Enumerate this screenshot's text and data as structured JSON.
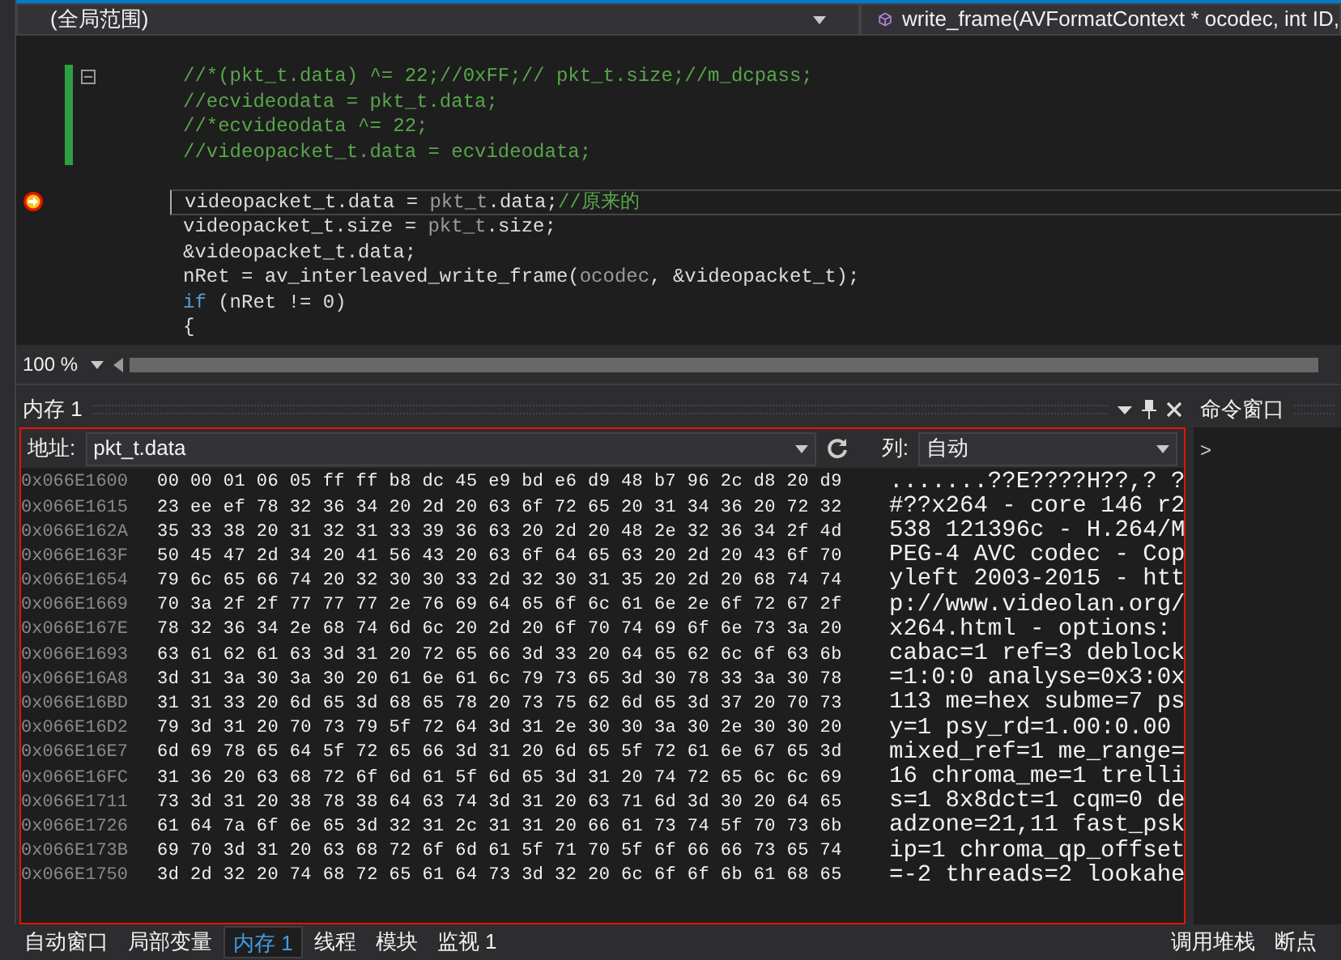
{
  "nav_bar": {
    "scope": "(全局范围)",
    "function": "write_frame(AVFormatContext * ocodec, int ID,"
  },
  "editor": {
    "lines": [
      {
        "kind": "blank"
      },
      {
        "kind": "code",
        "changed": true,
        "current": false,
        "fold": true,
        "segments": [
          {
            "kind": "comment",
            "text": "//*(pkt_t.data) ^= 22;//0xFF;// pkt_t.size;//m_dcpass;"
          }
        ]
      },
      {
        "kind": "code",
        "changed": true,
        "current": false,
        "fold": false,
        "segments": [
          {
            "kind": "comment",
            "text": "//ecvideodata = pkt_t.data;"
          }
        ]
      },
      {
        "kind": "code",
        "changed": true,
        "current": false,
        "fold": false,
        "segments": [
          {
            "kind": "comment",
            "text": "//*ecvideodata ^= 22;"
          }
        ]
      },
      {
        "kind": "code",
        "changed": true,
        "current": false,
        "fold": false,
        "segments": [
          {
            "kind": "comment",
            "text": "//videopacket_t.data = ecvideodata;"
          }
        ]
      },
      {
        "kind": "blank"
      },
      {
        "kind": "code",
        "changed": false,
        "current": true,
        "fold": false,
        "segments": [
          {
            "kind": "plain",
            "text": "videopacket_t.data = "
          },
          {
            "kind": "dim",
            "text": "pkt_t"
          },
          {
            "kind": "plain",
            "text": ".data;"
          },
          {
            "kind": "comment",
            "text": "//原来的"
          }
        ]
      },
      {
        "kind": "code",
        "changed": false,
        "current": false,
        "fold": false,
        "segments": [
          {
            "kind": "plain",
            "text": "videopacket_t.size = "
          },
          {
            "kind": "dim",
            "text": "pkt_t"
          },
          {
            "kind": "plain",
            "text": ".size;"
          }
        ]
      },
      {
        "kind": "code",
        "changed": false,
        "current": false,
        "fold": false,
        "segments": [
          {
            "kind": "plain",
            "text": "&videopacket_t.data;"
          }
        ]
      },
      {
        "kind": "code",
        "changed": false,
        "current": false,
        "fold": false,
        "segments": [
          {
            "kind": "plain",
            "text": "nRet = av_interleaved_write_frame("
          },
          {
            "kind": "dim",
            "text": "ocodec"
          },
          {
            "kind": "plain",
            "text": ", &videopacket_t);"
          }
        ]
      },
      {
        "kind": "code",
        "changed": false,
        "current": false,
        "fold": false,
        "segments": [
          {
            "kind": "keyword",
            "text": "if"
          },
          {
            "kind": "plain",
            "text": " (nRet != 0)"
          }
        ]
      },
      {
        "kind": "code",
        "changed": false,
        "current": false,
        "fold": false,
        "segments": [
          {
            "kind": "plain",
            "text": "{"
          }
        ]
      }
    ],
    "zoom": "100 %"
  },
  "memory": {
    "title": "内存 1",
    "address_label": "地址:",
    "address": "pkt_t.data",
    "columns_label": "列:",
    "columns": "自动",
    "rows": [
      {
        "address": "0x066E1600",
        "bytes": "00 00 01 06 05 ff ff b8 dc 45 e9 bd e6 d9 48 b7 96 2c d8 20 d9",
        "text": ".......??E????H??,? ?"
      },
      {
        "address": "0x066E1615",
        "bytes": "23 ee ef 78 32 36 34 20 2d 20 63 6f 72 65 20 31 34 36 20 72 32",
        "text": "#??x264 - core 146 r2"
      },
      {
        "address": "0x066E162A",
        "bytes": "35 33 38 20 31 32 31 33 39 36 63 20 2d 20 48 2e 32 36 34 2f 4d",
        "text": "538 121396c - H.264/M"
      },
      {
        "address": "0x066E163F",
        "bytes": "50 45 47 2d 34 20 41 56 43 20 63 6f 64 65 63 20 2d 20 43 6f 70",
        "text": "PEG-4 AVC codec - Cop"
      },
      {
        "address": "0x066E1654",
        "bytes": "79 6c 65 66 74 20 32 30 30 33 2d 32 30 31 35 20 2d 20 68 74 74",
        "text": "yleft 2003-2015 - htt"
      },
      {
        "address": "0x066E1669",
        "bytes": "70 3a 2f 2f 77 77 77 2e 76 69 64 65 6f 6c 61 6e 2e 6f 72 67 2f",
        "text": "p://www.videolan.org/"
      },
      {
        "address": "0x066E167E",
        "bytes": "78 32 36 34 2e 68 74 6d 6c 20 2d 20 6f 70 74 69 6f 6e 73 3a 20",
        "text": "x264.html - options: "
      },
      {
        "address": "0x066E1693",
        "bytes": "63 61 62 61 63 3d 31 20 72 65 66 3d 33 20 64 65 62 6c 6f 63 6b",
        "text": "cabac=1 ref=3 deblock"
      },
      {
        "address": "0x066E16A8",
        "bytes": "3d 31 3a 30 3a 30 20 61 6e 61 6c 79 73 65 3d 30 78 33 3a 30 78",
        "text": "=1:0:0 analyse=0x3:0x"
      },
      {
        "address": "0x066E16BD",
        "bytes": "31 31 33 20 6d 65 3d 68 65 78 20 73 75 62 6d 65 3d 37 20 70 73",
        "text": "113 me=hex subme=7 ps"
      },
      {
        "address": "0x066E16D2",
        "bytes": "79 3d 31 20 70 73 79 5f 72 64 3d 31 2e 30 30 3a 30 2e 30 30 20",
        "text": "y=1 psy_rd=1.00:0.00 "
      },
      {
        "address": "0x066E16E7",
        "bytes": "6d 69 78 65 64 5f 72 65 66 3d 31 20 6d 65 5f 72 61 6e 67 65 3d",
        "text": "mixed_ref=1 me_range="
      },
      {
        "address": "0x066E16FC",
        "bytes": "31 36 20 63 68 72 6f 6d 61 5f 6d 65 3d 31 20 74 72 65 6c 6c 69",
        "text": "16 chroma_me=1 trelli"
      },
      {
        "address": "0x066E1711",
        "bytes": "73 3d 31 20 38 78 38 64 63 74 3d 31 20 63 71 6d 3d 30 20 64 65",
        "text": "s=1 8x8dct=1 cqm=0 de"
      },
      {
        "address": "0x066E1726",
        "bytes": "61 64 7a 6f 6e 65 3d 32 31 2c 31 31 20 66 61 73 74 5f 70 73 6b",
        "text": "adzone=21,11 fast_psk"
      },
      {
        "address": "0x066E173B",
        "bytes": "69 70 3d 31 20 63 68 72 6f 6d 61 5f 71 70 5f 6f 66 66 73 65 74",
        "text": "ip=1 chroma_qp_offset"
      },
      {
        "address": "0x066E1750",
        "bytes": "3d 2d 32 20 74 68 72 65 61 64 73 3d 32 20 6c 6f 6f 6b 61 68 65",
        "text": "=-2 threads=2 lookahe"
      }
    ]
  },
  "command_window": {
    "title": "命令窗口",
    "prompt": ">"
  },
  "bottom_tabs_left": [
    {
      "label": "自动窗口",
      "selected": false
    },
    {
      "label": "局部变量",
      "selected": false
    },
    {
      "label": "内存 1",
      "selected": true
    },
    {
      "label": "线程",
      "selected": false
    },
    {
      "label": "模块",
      "selected": false
    },
    {
      "label": "监视 1",
      "selected": false
    }
  ],
  "bottom_tabs_right": [
    {
      "label": "调用堆栈",
      "selected": false
    },
    {
      "label": "断点",
      "selected": false
    }
  ]
}
